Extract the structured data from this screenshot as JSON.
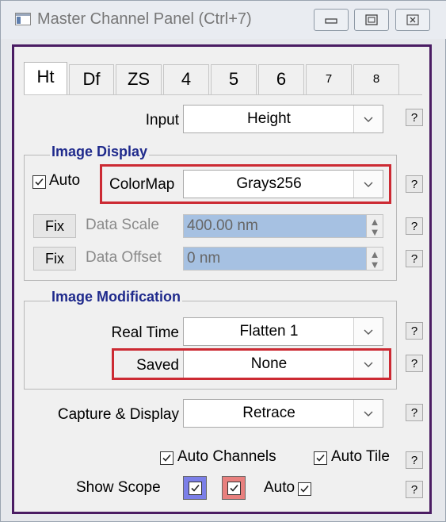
{
  "window": {
    "title": "Master Channel Panel (Ctrl+7)",
    "icons": {
      "app": "app-window-icon",
      "minimize": "minimize-icon",
      "restore": "restore-icon",
      "close": "close-icon"
    }
  },
  "tabs": [
    {
      "label": "Ht",
      "active": true
    },
    {
      "label": "Df"
    },
    {
      "label": "ZS"
    },
    {
      "label": "4"
    },
    {
      "label": "5"
    },
    {
      "label": "6"
    },
    {
      "label": "7"
    },
    {
      "label": "8"
    }
  ],
  "input": {
    "label": "Input",
    "value": "Height"
  },
  "image_display": {
    "heading": "Image Display",
    "auto_label": "Auto",
    "auto_checked": true,
    "colormap": {
      "label": "ColorMap",
      "value": "Grays256"
    },
    "data_scale": {
      "fix_label": "Fix",
      "label": "Data Scale",
      "value": "400.00 nm"
    },
    "data_offset": {
      "fix_label": "Fix",
      "label": "Data Offset",
      "value": "0 nm"
    }
  },
  "image_modification": {
    "heading": "Image Modification",
    "real_time": {
      "label": "Real Time",
      "value": "Flatten 1"
    },
    "saved": {
      "label": "Saved",
      "value": "None"
    }
  },
  "capture_display": {
    "label": "Capture & Display",
    "value": "Retrace"
  },
  "options": {
    "auto_channels": {
      "label": "Auto Channels",
      "checked": true
    },
    "auto_tile": {
      "label": "Auto Tile",
      "checked": true
    },
    "show_scope": {
      "label": "Show Scope",
      "trace_color": "#7b7fe8",
      "retrace_color": "#e8807e"
    },
    "auto": {
      "label": "Auto",
      "checked": true
    }
  },
  "help_label": "?",
  "colors": {
    "panel_border": "#4a1c63",
    "highlight": "#cc2a33",
    "heading": "#1f2a8c",
    "field_selected": "#a6c1e2"
  }
}
